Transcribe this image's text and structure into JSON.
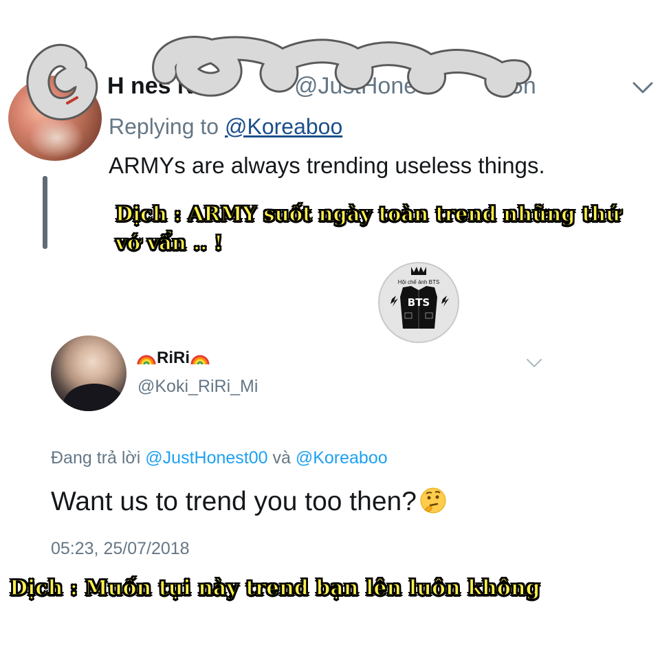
{
  "tweet1": {
    "name": "H  nes  NK",
    "handle": "@JustHone  o",
    "time": "5h",
    "reply_prefix": "Replying to ",
    "reply_mention": "@Koreaboo",
    "text": "ARMYs are always trending useless things."
  },
  "caption1": {
    "line1": "Dịch : ARMY suốt ngày toàn trend những thứ",
    "line2": "vớ vẩn .. !"
  },
  "logo": {
    "top_text": "Hội chế ảnh BTS",
    "center_text": "BTS"
  },
  "tweet2": {
    "name": "RiRi",
    "handle": "@Koki_RiRi_Mi",
    "reply_prefix": "Đang trả lời ",
    "reply_mention1": "@JustHonest00",
    "reply_join": " và ",
    "reply_mention2": "@Koreaboo",
    "text": "Want us to trend you too then?",
    "timestamp": "05:23, 25/07/2018"
  },
  "caption2": {
    "text": "Dịch : Muốn tụi này trend bạn lên luôn không"
  },
  "icons": {
    "chevron": "chevron-down-icon",
    "thinking": "thinking-face-emoji",
    "rainbow": "rainbow-emoji"
  }
}
